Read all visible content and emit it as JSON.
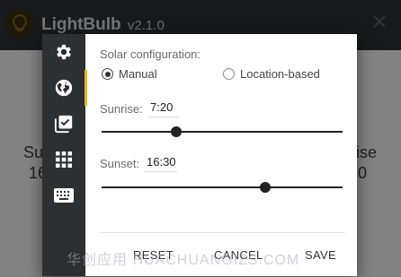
{
  "app": {
    "title": "LightBulb",
    "version": "v2.1.0",
    "background_left_text_1": "Su",
    "background_left_text_2": "16",
    "background_right_text_1": "ise",
    "background_right_text_2": "0"
  },
  "dialog": {
    "section_label": "Solar configuration:",
    "mode_options": [
      {
        "label": "Manual",
        "selected": true
      },
      {
        "label": "Location-based",
        "selected": false
      }
    ],
    "sunrise": {
      "label": "Sunrise:",
      "value": "7:20",
      "slider_fraction": 0.31
    },
    "sunset": {
      "label": "Sunset:",
      "value": "16:30",
      "slider_fraction": 0.68
    },
    "buttons": {
      "reset": "RESET",
      "cancel": "CANCEL",
      "save": "SAVE"
    },
    "sidebar_icons": [
      "gear-icon",
      "globe-icon",
      "checklist-icon",
      "apps-grid-icon",
      "keyboard-icon"
    ],
    "active_tab": "globe-icon"
  },
  "watermark": "华创应用 HUACHUANGIZS.COM",
  "colors": {
    "rail": "#2d3032",
    "active_indicator": "#f0b41c",
    "titlebar": "#2e3133"
  }
}
